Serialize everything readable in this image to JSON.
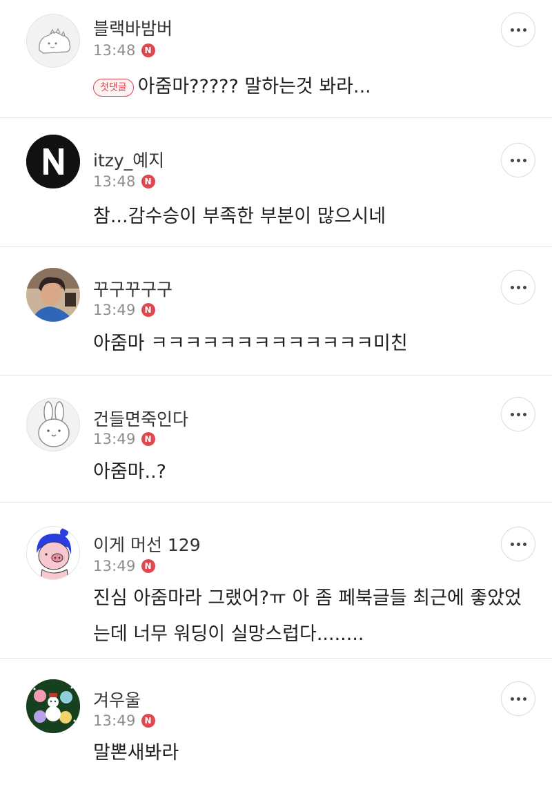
{
  "badges": {
    "new_symbol": "N",
    "first_comment": "첫댓글"
  },
  "colors": {
    "accent": "#e0474f",
    "divider": "#e6e6e6",
    "meta_text": "#8e8e8e"
  },
  "comments": [
    {
      "author": "블랙바밤버",
      "time": "13:48",
      "text": "아줌마????? 말하는것 봐라...",
      "avatar": "dinosaur-sketch",
      "first": true
    },
    {
      "author": "itzy_예지",
      "time": "13:48",
      "text": "참...감수승이 부족한 부분이 많으시네",
      "avatar": "letter-n-logo"
    },
    {
      "author": "꾸구꾸구구",
      "time": "13:49",
      "text": "아줌마 ㅋㅋㅋㅋㅋㅋㅋㅋㅋㅋㅋㅋㅋ미친",
      "avatar": "person-photo"
    },
    {
      "author": "건들면죽인다",
      "time": "13:49",
      "text": "아줌마..?",
      "avatar": "bunny-sketch"
    },
    {
      "author": "이게 머선 129",
      "time": "13:49",
      "text": "진심 아줌마라 그랬어?ㅠ 아 좀 페북글들 최근에 좋았었는데 너무 워딩이 실망스럽다........",
      "avatar": "blue-hair-character"
    },
    {
      "author": "겨우울",
      "time": "13:49",
      "text": "말뽄새봐라",
      "avatar": "winter-characters"
    }
  ]
}
